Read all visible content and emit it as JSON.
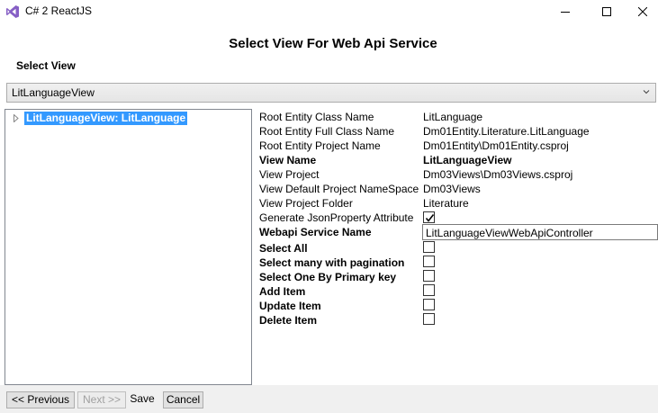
{
  "window": {
    "title": "C# 2 ReactJS",
    "logo_icon": "visual-studio-logo",
    "controls": {
      "minimize": "minimize-icon",
      "maximize": "maximize-icon",
      "close": "close-icon"
    }
  },
  "dialog": {
    "heading": "Select View For Web Api Service",
    "select_view_label": "Select View",
    "select_view_value": "LitLanguageView"
  },
  "tree": {
    "selected_node": "LitLanguageView: LitLanguage"
  },
  "properties": [
    {
      "label": "Root Entity Class Name",
      "value": "LitLanguage",
      "bold": false
    },
    {
      "label": "Root Entity Full Class Name",
      "value": "Dm01Entity.Literature.LitLanguage",
      "bold": false
    },
    {
      "label": "Root Entity Project Name",
      "value": "Dm01Entity\\Dm01Entity.csproj",
      "bold": false
    },
    {
      "label": "View Name",
      "value": "LitLanguageView",
      "bold": true
    },
    {
      "label": "View Project",
      "value": "Dm03Views\\Dm03Views.csproj",
      "bold": false
    },
    {
      "label": "View Default Project NameSpace",
      "value": "Dm03Views",
      "bold": false
    },
    {
      "label": "View Project Folder",
      "value": "Literature",
      "bold": false
    }
  ],
  "generate_json": {
    "label": "Generate JsonProperty Attribute",
    "checked": true
  },
  "webapi_service": {
    "label": "Webapi Service Name",
    "value": "LitLanguageViewWebApiController"
  },
  "options": [
    {
      "label": "Select All",
      "checked": false
    },
    {
      "label": "Select many with pagination",
      "checked": false
    },
    {
      "label": "Select One By Primary key",
      "checked": false
    },
    {
      "label": "Add Item",
      "checked": false
    },
    {
      "label": "Update Item",
      "checked": false
    },
    {
      "label": "Delete Item",
      "checked": false
    }
  ],
  "footer": {
    "previous": "<< Previous",
    "next": "Next >>",
    "save": "Save",
    "cancel": "Cancel"
  }
}
